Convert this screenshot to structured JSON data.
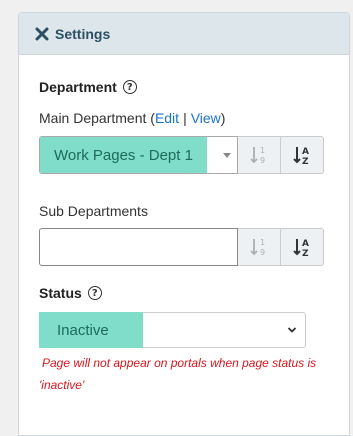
{
  "header": {
    "title": "Settings",
    "close_icon": "close-x-icon"
  },
  "department": {
    "title": "Department",
    "main_label": "Main Department (",
    "edit_link": "Edit",
    "separator": "|",
    "view_link": "View",
    "main_label_close": ")",
    "main_selected": "Work Pages - Dept 1",
    "sub_label": "Sub Departments",
    "sub_selected": ""
  },
  "status": {
    "title": "Status",
    "selected": "Inactive",
    "warning": "Page will not appear on portals when page status is 'inactive'"
  },
  "colors": {
    "chip_bg": "#7fddc9",
    "header_bg": "#dde6ea",
    "link": "#1a73c9",
    "warning": "#d6171d"
  }
}
